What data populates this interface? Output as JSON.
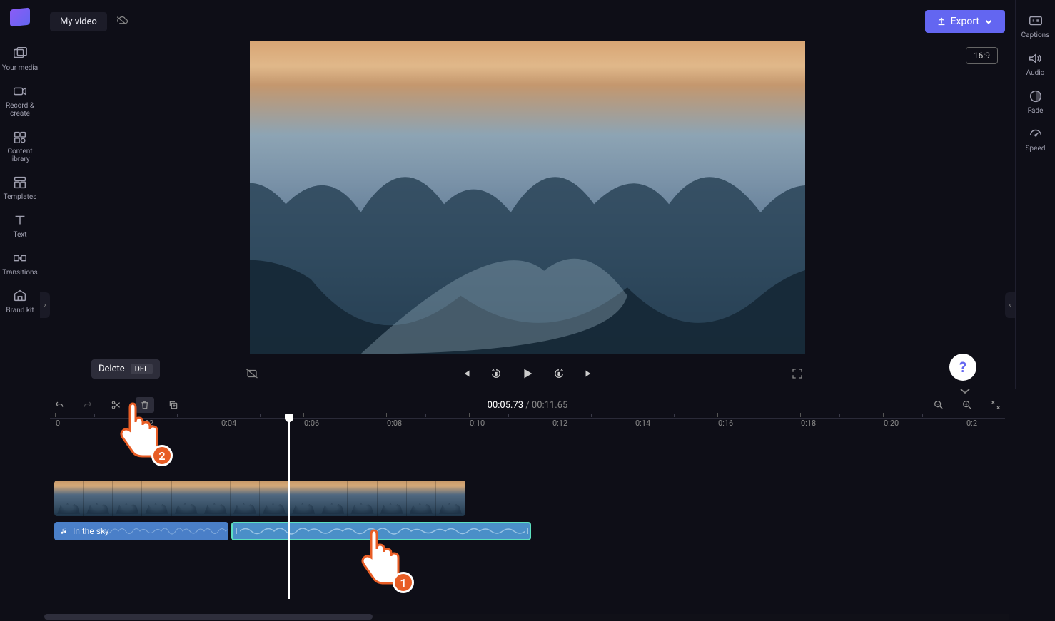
{
  "project": {
    "name": "My video"
  },
  "export": {
    "label": "Export"
  },
  "aspect": {
    "label": "16:9"
  },
  "left_nav": [
    {
      "name": "your-media",
      "label": "Your media"
    },
    {
      "name": "record-create",
      "label": "Record & create"
    },
    {
      "name": "content-library",
      "label": "Content library"
    },
    {
      "name": "templates",
      "label": "Templates"
    },
    {
      "name": "text",
      "label": "Text"
    },
    {
      "name": "transitions",
      "label": "Transitions"
    },
    {
      "name": "brand-kit",
      "label": "Brand kit"
    }
  ],
  "right_nav": [
    {
      "name": "captions",
      "label": "Captions"
    },
    {
      "name": "audio",
      "label": "Audio"
    },
    {
      "name": "fade",
      "label": "Fade"
    },
    {
      "name": "speed",
      "label": "Speed"
    }
  ],
  "tooltip": {
    "label": "Delete",
    "key": "DEL"
  },
  "timecode": {
    "current": "00:05.73",
    "total": "00:11.65"
  },
  "ruler": [
    "0",
    "0:02",
    "0:04",
    "0:06",
    "0:08",
    "0:10",
    "0:12",
    "0:14",
    "0:16",
    "0:18",
    "0:20",
    "0:2"
  ],
  "audio_clip": {
    "label": "In the sky"
  },
  "pointers": {
    "p1": "1",
    "p2": "2"
  },
  "help": {
    "label": "?"
  }
}
